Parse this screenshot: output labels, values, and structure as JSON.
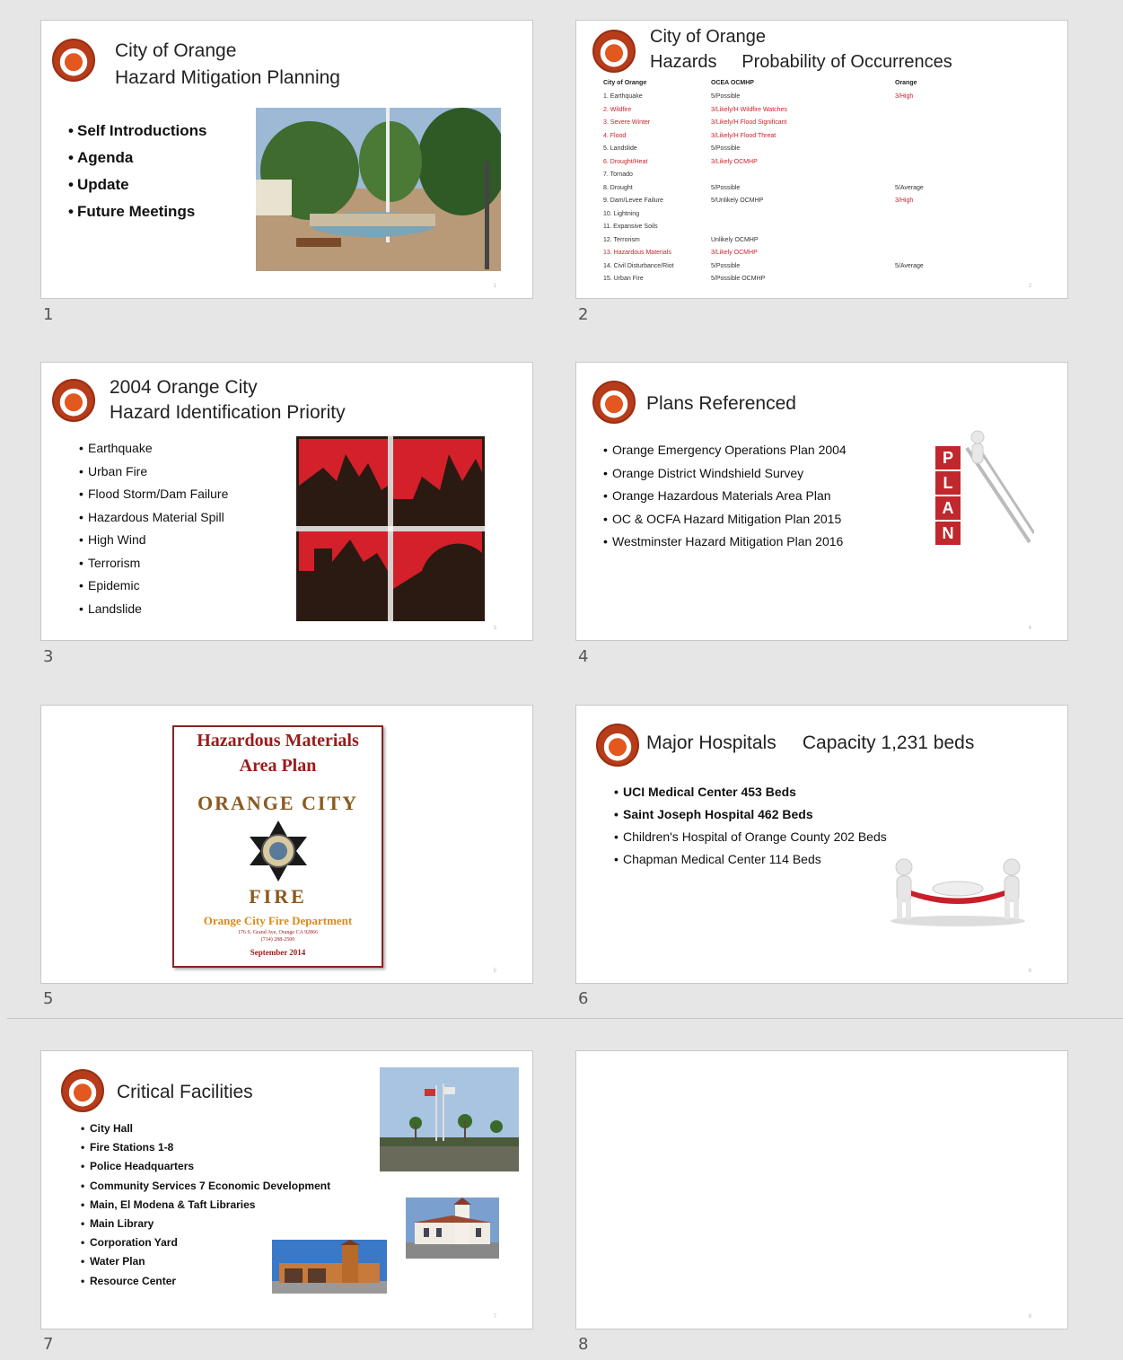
{
  "slides": [
    {
      "number": "1",
      "title_line1": "City of Orange",
      "title_line2": "Hazard Mitigation Planning",
      "bullets": [
        "Self Introductions",
        "Agenda",
        "Update",
        "Future Meetings"
      ]
    },
    {
      "number": "2",
      "title_line1": "City of Orange",
      "title_line2": "Hazards     Probability of Occurrences",
      "table_headers": [
        "City of Orange",
        "OCEA OCMHP",
        "Orange"
      ],
      "rows": [
        {
          "name": "1. Earthquake",
          "col2": "5/Possible",
          "col3": "3/High",
          "red": false
        },
        {
          "name": "2. Wildfire",
          "col2": "3/Likely/H Wildfire Watches",
          "col3": "",
          "red": true
        },
        {
          "name": "3. Severe Winter",
          "col2": "3/Likely/H Flood Significant",
          "col3": "",
          "red": true
        },
        {
          "name": "4. Flood",
          "col2": "3/Likely/H Flood Threat",
          "col3": "",
          "red": true
        },
        {
          "name": "5. Landslide",
          "col2": "5/Possible",
          "col3": "",
          "red": false
        },
        {
          "name": "6. Drought/Heat",
          "col2": "3/Likely OCMHP",
          "col3": "",
          "red": true
        },
        {
          "name": "7. Tornado",
          "col2": "",
          "col3": "",
          "red": false
        },
        {
          "name": "8. Drought",
          "col2": "5/Possible",
          "col3": "5/Average",
          "red": false
        },
        {
          "name": "9. Dam/Levee Failure",
          "col2": "5/Unlikely OCMHP",
          "col3": "3/High",
          "red": false
        },
        {
          "name": "10. Lightning",
          "col2": "",
          "col3": "",
          "red": false
        },
        {
          "name": "11. Expansive Soils",
          "col2": "",
          "col3": "",
          "red": false
        },
        {
          "name": "12. Terrorism",
          "col2": "Unlikely OCMHP",
          "col3": "",
          "red": false
        },
        {
          "name": "13. Hazardous Materials",
          "col2": "3/Likely OCMHP",
          "col3": "",
          "red": true
        },
        {
          "name": "14. Civil Disturbance/Riot",
          "col2": "5/Possible",
          "col3": "5/Average",
          "red": false
        },
        {
          "name": "15. Urban Fire",
          "col2": "5/Possible OCMHP",
          "col3": "",
          "red": false
        }
      ]
    },
    {
      "number": "3",
      "title_line1": "2004 Orange City",
      "title_line2": "Hazard Identification Priority",
      "bullets": [
        "Earthquake",
        "Urban Fire",
        "Flood Storm/Dam Failure",
        "Hazardous Material Spill",
        "High Wind",
        "Terrorism",
        "Epidemic",
        "Landslide"
      ]
    },
    {
      "number": "4",
      "title": "Plans Referenced",
      "bullets": [
        "Orange Emergency Operations Plan 2004",
        "Orange District Windshield Survey",
        "Orange Hazardous Materials Area Plan",
        "OC & OCFA Hazard Mitigation Plan 2015",
        "Westminster Hazard Mitigation Plan 2016"
      ],
      "plan_letters": [
        "P",
        "L",
        "A",
        "N"
      ]
    },
    {
      "number": "5",
      "cover_title1": "Hazardous Materials",
      "cover_title2": "Area Plan",
      "arc_text": "ORANGE CITY",
      "fire_text": "FIRE",
      "dept": "Orange City Fire Department",
      "address1": "176 S. Grand Ave, Orange CA 92866",
      "address2": "(714) 288-2500",
      "date": "September 2014"
    },
    {
      "number": "6",
      "title": "Major Hospitals     Capacity 1,231 beds",
      "bullets": [
        "UCI Medical Center 453 Beds",
        "Saint Joseph Hospital 462 Beds",
        "Children's Hospital of Orange County 202 Beds",
        "Chapman Medical Center 114 Beds"
      ]
    },
    {
      "number": "7",
      "title": "Critical Facilities",
      "bullets": [
        "City Hall",
        "Fire Stations 1-8",
        "Police Headquarters",
        "Community Services 7 Economic Development",
        "Main, El Modena & Taft Libraries",
        "Main Library",
        "Corporation Yard",
        "Water Plan",
        "Resource Center"
      ]
    },
    {
      "number": "8"
    }
  ],
  "colors": {
    "accent_red": "#c8102e",
    "dark_red": "#9b1b1b",
    "gold": "#d98a1a"
  }
}
